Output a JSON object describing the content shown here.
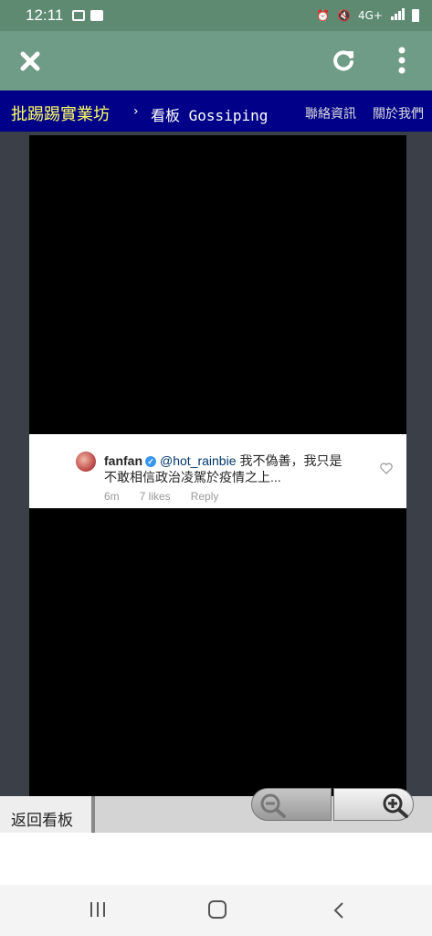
{
  "status_bar": {
    "time": "12:11",
    "icons_left": [
      "image-icon",
      "check-box-icon"
    ],
    "icons_right": [
      "alarm-icon",
      "mute-icon",
      "4g-lte-icon",
      "signal-icon",
      "battery-icon"
    ],
    "network_label": "4G+"
  },
  "app_bar": {
    "icons": [
      "close-icon",
      "refresh-icon",
      "more-vert-icon"
    ]
  },
  "ptt_header": {
    "site_name": "批踢踢實業坊",
    "separator": "›",
    "board_prefix": "看板",
    "board_name": "Gossiping",
    "nav_contact": "聯絡資訊",
    "nav_about": "關於我們"
  },
  "comment": {
    "username": "fanfan",
    "verified_mark": "✓",
    "mention": "@hot_rainbie",
    "text_line1": "我不偽善，我只是",
    "text_line2": "不敢相信政治凌駕於疫情之上...",
    "time": "6m",
    "likes": "7 likes",
    "reply": "Reply"
  },
  "footer": {
    "back_label": "返回看板"
  },
  "colors": {
    "status_bar": "#5e8a72",
    "app_bar": "#6f9c86",
    "ptt_header": "#000088",
    "logo": "#ffff66"
  }
}
